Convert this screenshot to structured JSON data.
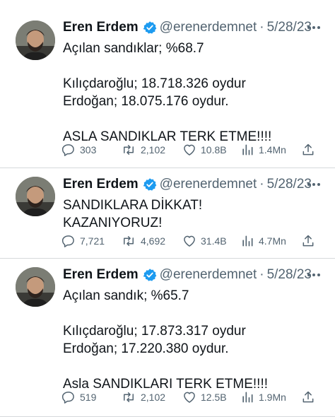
{
  "colors": {
    "verified": "#1d9bf0",
    "muted": "#536471",
    "divider": "#d6d9db"
  },
  "tweets": [
    {
      "name": "Eren Erdem",
      "handle": "@erenerdemnet",
      "separator": "·",
      "date": "5/28/23",
      "text": "Açılan sandıklar; %68.7\n\nKılıçdaroğlu; 18.718.326 oydur\nErdoğan; 18.075.176 oydur.\n\nASLA SANDIKLAR TERK ETME!!!!",
      "replies": "303",
      "retweets": "2,102",
      "likes": "10.8B",
      "views": "1.4Mn"
    },
    {
      "name": "Eren Erdem",
      "handle": "@erenerdemnet",
      "separator": "·",
      "date": "5/28/23",
      "text": "SANDIKLARA DİKKAT!\nKAZANIYORUZ!",
      "replies": "7,721",
      "retweets": "4,692",
      "likes": "31.4B",
      "views": "4.7Mn"
    },
    {
      "name": "Eren Erdem",
      "handle": "@erenerdemnet",
      "separator": "·",
      "date": "5/28/23",
      "text": "Açılan sandık; %65.7\n\nKılıçdaroğlu; 17.873.317 oydur\nErdoğan; 17.220.380 oydur.\n\nAsla SANDIKLARI TERK ETME!!!!",
      "replies": "519",
      "retweets": "2,102",
      "likes": "12.5B",
      "views": "1.9Mn"
    }
  ]
}
